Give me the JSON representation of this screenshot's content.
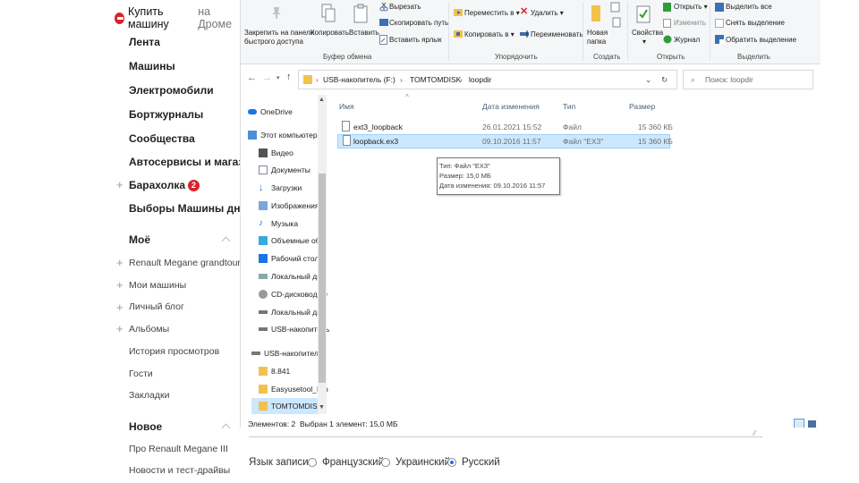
{
  "site": {
    "logo_bold": "Купить машину",
    "logo_muted": "на Дроме",
    "nav": [
      "Лента",
      "Машины",
      "Электромобили",
      "Бортжурналы",
      "Сообщества",
      "Автосервисы и магазины"
    ],
    "baraholka": "Барахолка",
    "baraholka_badge": "2",
    "vybory": "Выборы Машины дня",
    "my_section": "Моё",
    "my_items": [
      "Renault Megane grandtour",
      "Мои машины",
      "Личный блог",
      "Альбомы",
      "История просмотров",
      "Гости",
      "Закладки"
    ],
    "new_section": "Новое",
    "new_items": [
      "Про Renault Megane III",
      "Новости и тест-драйвы"
    ]
  },
  "ribbon": {
    "pin": "Закрепить на панели\nбыстрого доступа",
    "copy": "Копировать",
    "paste": "Вставить",
    "cut": "Вырезать",
    "copy_path": "Скопировать путь",
    "paste_shortcut": "Вставить ярлык",
    "move_to": "Переместить в ▾",
    "delete": "Удалить ▾",
    "copy_to": "Копировать в ▾",
    "rename": "Переименовать",
    "new_folder": "Новая\nпапка",
    "properties": "Свойства",
    "open": "Открыть ▾",
    "edit": "Изменить",
    "history": "Журнал",
    "select_all": "Выделить все",
    "select_none": "Снять выделение",
    "invert_selection": "Обратить выделение",
    "groups": {
      "clipboard": "Буфер обмена",
      "organize": "Упорядочить",
      "create": "Создать",
      "open": "Открыть",
      "select": "Выделить"
    }
  },
  "address": {
    "crumbs": [
      "USB-накопитель (F:)",
      "TOMTOMDISK",
      "loopdir"
    ],
    "search_placeholder": "Поиск: loopdir"
  },
  "navpane": {
    "items": [
      "OneDrive",
      "Этот компьютер",
      "Видео",
      "Документы",
      "Загрузки",
      "Изображения",
      "Музыка",
      "Объемные объ",
      "Рабочий стол",
      "Локальный дис",
      "CD-дисковод (D",
      "Локальный дис",
      "USB-накопитель",
      "USB-накопитель",
      "8.841",
      "Easyusetool_Fro",
      "TOMTOMDISK"
    ]
  },
  "files": {
    "headers": {
      "name": "Имя",
      "date": "Дата изменения",
      "type": "Тип",
      "size": "Размер"
    },
    "rows": [
      {
        "name": "ext3_loopback",
        "date": "26.01.2021 15:52",
        "type": "Файл",
        "size": "15 360 КБ"
      },
      {
        "name": "loopback.ex3",
        "date": "09.10.2016 11:57",
        "type": "Файл \"EX3\"",
        "size": "15 360 КБ"
      }
    ],
    "tooltip": [
      "Тип: Файл \"EX3\"",
      "Размер: 15,0 МБ",
      "Дата изменения: 09.10.2016 11:57"
    ]
  },
  "status": {
    "count": "Элементов: 2",
    "selected": "Выбран 1 элемент: 15,0 МБ"
  },
  "form": {
    "label": "Язык записи",
    "options": [
      "Французский",
      "Украинский",
      "Русский"
    ],
    "selected": "Русский"
  },
  "colors": {
    "accent": "#d8232a",
    "selection": "#cce8ff",
    "link": "#1a73e8"
  }
}
